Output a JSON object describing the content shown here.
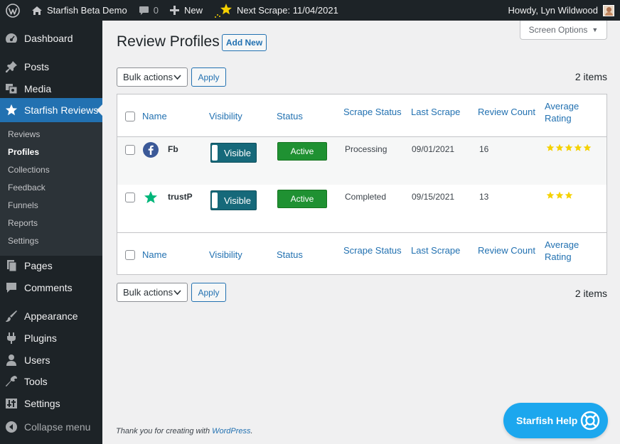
{
  "adminbar": {
    "site_name": "Starfish Beta Demo",
    "comments_count": "0",
    "new_label": "New",
    "next_scrape": "Next Scrape: 11/04/2021",
    "howdy": "Howdy, Lyn Wildwood"
  },
  "sidebar": {
    "items": [
      {
        "label": "Dashboard",
        "icon": "dashboard-icon"
      },
      {
        "label": "Posts",
        "icon": "pin-icon"
      },
      {
        "label": "Media",
        "icon": "media-icon"
      },
      {
        "label": "Starfish Reviews",
        "icon": "star-icon"
      },
      {
        "label": "Pages",
        "icon": "page-icon"
      },
      {
        "label": "Comments",
        "icon": "comment-icon"
      },
      {
        "label": "Appearance",
        "icon": "brush-icon"
      },
      {
        "label": "Plugins",
        "icon": "plugin-icon"
      },
      {
        "label": "Users",
        "icon": "user-icon"
      },
      {
        "label": "Tools",
        "icon": "wrench-icon"
      },
      {
        "label": "Settings",
        "icon": "sliders-icon"
      }
    ],
    "submenu": [
      "Reviews",
      "Profiles",
      "Collections",
      "Feedback",
      "Funnels",
      "Reports",
      "Settings"
    ],
    "collapse_label": "Collapse menu"
  },
  "main": {
    "screen_options": "Screen Options",
    "title": "Review Profiles",
    "add_new": "Add New",
    "bulk_actions": "Bulk actions",
    "apply": "Apply",
    "items_count": "2 items",
    "columns": {
      "name": "Name",
      "visibility": "Visibility",
      "status": "Status",
      "scrape_status": "Scrape Status",
      "last_scrape": "Last Scrape",
      "review_count": "Review Count",
      "average_line1": "Average",
      "average_line2": "Rating"
    },
    "rows": [
      {
        "name": "Fb",
        "icon": "facebook-icon",
        "visibility": "Visible",
        "status": "Active",
        "scrape_status": "Processing",
        "last_scrape": "09/01/2021",
        "review_count": "16",
        "rating": 5
      },
      {
        "name": "trustP",
        "icon": "trustpilot-star-icon",
        "visibility": "Visible",
        "status": "Active",
        "scrape_status": "Completed",
        "last_scrape": "09/15/2021",
        "review_count": "13",
        "rating": 3
      }
    ]
  },
  "footer": {
    "text": "Thank you for creating with ",
    "link": "WordPress",
    "period": ".",
    "version": ""
  },
  "help_button": "Starfish Help",
  "colors": {
    "admin_dark": "#1d2327",
    "accent_blue": "#2271b1",
    "toggle_teal": "#16697a",
    "active_green": "#1f9132",
    "help_blue": "#1ca7ee",
    "star_yellow": "#f5d100"
  }
}
